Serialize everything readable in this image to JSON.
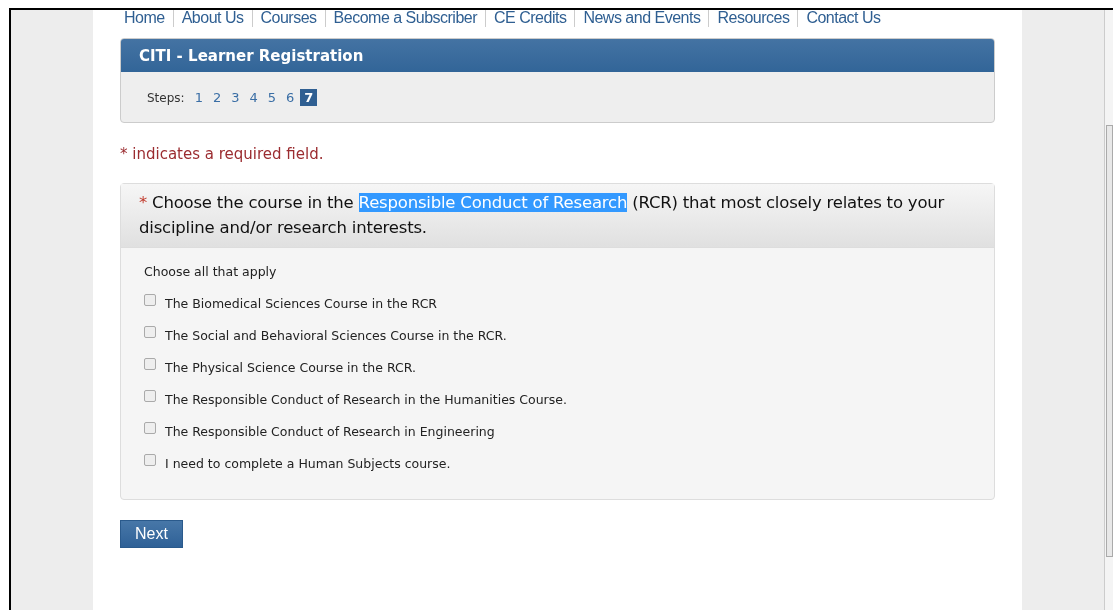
{
  "nav": [
    {
      "label": "Home"
    },
    {
      "label": "About Us"
    },
    {
      "label": "Courses"
    },
    {
      "label": "Become a Subscriber"
    },
    {
      "label": "CE Credits"
    },
    {
      "label": "News and Events"
    },
    {
      "label": "Resources"
    },
    {
      "label": "Contact Us"
    }
  ],
  "panel": {
    "title": "CITI - Learner Registration",
    "steps_label": "Steps:",
    "steps": [
      {
        "label": "1",
        "selected": false
      },
      {
        "label": "2",
        "selected": false
      },
      {
        "label": "3",
        "selected": false
      },
      {
        "label": "4",
        "selected": false
      },
      {
        "label": "5",
        "selected": false
      },
      {
        "label": "6",
        "selected": false
      },
      {
        "label": "7",
        "selected": true
      }
    ]
  },
  "required_note": "* indicates a required field.",
  "question": {
    "required_mark": "*",
    "segments": [
      {
        "text": "Choose the course in the ",
        "highlighted": false
      },
      {
        "text": "Responsible Conduct of Research",
        "highlighted": true
      },
      {
        "text": " (RCR) that most closely relates to your discipline and/or research interests.",
        "highlighted": false
      }
    ],
    "instruction": "Choose all that apply",
    "options": [
      {
        "label": "The Biomedical Sciences Course in the RCR",
        "checked": false
      },
      {
        "label": "The Social and Behavioral Sciences Course in the RCR.",
        "checked": false
      },
      {
        "label": "The Physical Science Course in the RCR.",
        "checked": false
      },
      {
        "label": "The Responsible Conduct of Research in the Humanities Course.",
        "checked": false
      },
      {
        "label": "The Responsible Conduct of Research in Engineering",
        "checked": false
      },
      {
        "label": "I need to complete a Human Subjects course.",
        "checked": false
      }
    ]
  },
  "next_button": "Next"
}
